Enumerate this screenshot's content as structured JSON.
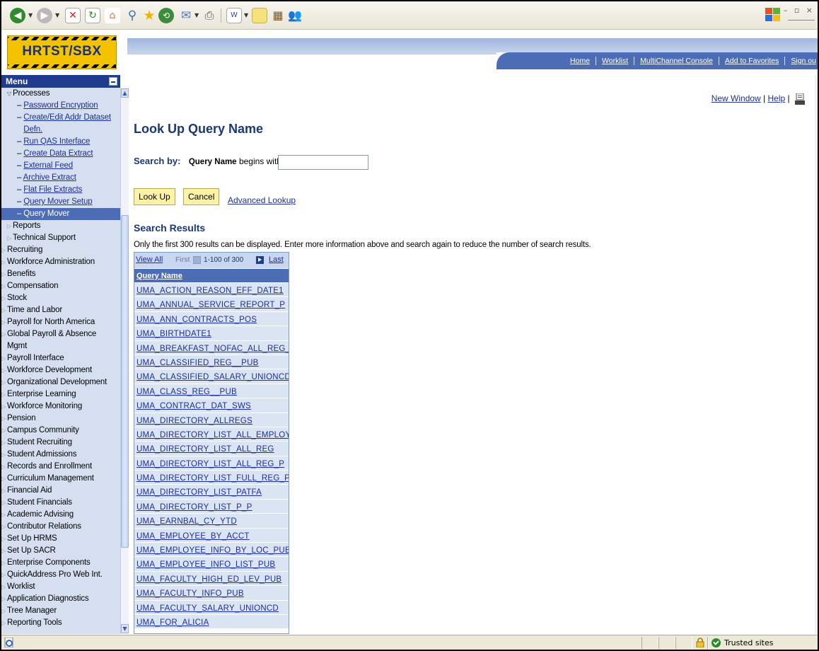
{
  "app": {
    "logo_text": "HRTST/SBX"
  },
  "header_nav": {
    "links": [
      "Home",
      "Worklist",
      "MultiChannel Console",
      "Add to Favorites",
      "Sign ou"
    ]
  },
  "window_controls": "– ▫ ×",
  "menu": {
    "title": "Menu",
    "items": [
      {
        "label": "Processes",
        "level": 1,
        "type": "folder-open"
      },
      {
        "label": "Password Encryption",
        "level": 2,
        "type": "link"
      },
      {
        "label": "Create/Edit Addr Dataset Defn.",
        "level": 2,
        "type": "link",
        "wrap": true
      },
      {
        "label": "Run QAS Interface",
        "level": 2,
        "type": "link"
      },
      {
        "label": "Create Data Extract",
        "level": 2,
        "type": "link"
      },
      {
        "label": "External Feed",
        "level": 2,
        "type": "link"
      },
      {
        "label": "Archive Extract",
        "level": 2,
        "type": "link"
      },
      {
        "label": "Flat File Extracts",
        "level": 2,
        "type": "link"
      },
      {
        "label": "Query Mover Setup",
        "level": 2,
        "type": "link"
      },
      {
        "label": "Query Mover",
        "level": 2,
        "type": "link",
        "active": true
      },
      {
        "label": "Reports",
        "level": 1,
        "type": "folder"
      },
      {
        "label": "Technical Support",
        "level": 1,
        "type": "folder"
      },
      {
        "label": "Recruiting",
        "level": 0,
        "type": "folder"
      },
      {
        "label": "Workforce Administration",
        "level": 0,
        "type": "folder"
      },
      {
        "label": "Benefits",
        "level": 0,
        "type": "folder"
      },
      {
        "label": "Compensation",
        "level": 0,
        "type": "folder"
      },
      {
        "label": "Stock",
        "level": 0,
        "type": "folder"
      },
      {
        "label": "Time and Labor",
        "level": 0,
        "type": "folder"
      },
      {
        "label": "Payroll for North America",
        "level": 0,
        "type": "folder"
      },
      {
        "label": "Global Payroll & Absence Mgmt",
        "level": 0,
        "type": "folder",
        "wrap": true
      },
      {
        "label": "Payroll Interface",
        "level": 0,
        "type": "folder"
      },
      {
        "label": "Workforce Development",
        "level": 0,
        "type": "folder"
      },
      {
        "label": "Organizational Development",
        "level": 0,
        "type": "folder"
      },
      {
        "label": "Enterprise Learning",
        "level": 0,
        "type": "folder"
      },
      {
        "label": "Workforce Monitoring",
        "level": 0,
        "type": "folder"
      },
      {
        "label": "Pension",
        "level": 0,
        "type": "folder"
      },
      {
        "label": "Campus Community",
        "level": 0,
        "type": "folder"
      },
      {
        "label": "Student Recruiting",
        "level": 0,
        "type": "folder"
      },
      {
        "label": "Student Admissions",
        "level": 0,
        "type": "folder"
      },
      {
        "label": "Records and Enrollment",
        "level": 0,
        "type": "folder"
      },
      {
        "label": "Curriculum Management",
        "level": 0,
        "type": "folder"
      },
      {
        "label": "Financial Aid",
        "level": 0,
        "type": "folder"
      },
      {
        "label": "Student Financials",
        "level": 0,
        "type": "folder"
      },
      {
        "label": "Academic Advising",
        "level": 0,
        "type": "folder"
      },
      {
        "label": "Contributor Relations",
        "level": 0,
        "type": "folder"
      },
      {
        "label": "Set Up HRMS",
        "level": 0,
        "type": "folder"
      },
      {
        "label": "Set Up SACR",
        "level": 0,
        "type": "folder"
      },
      {
        "label": "Enterprise Components",
        "level": 0,
        "type": "folder"
      },
      {
        "label": "QuickAddress Pro Web Int.",
        "level": 0,
        "type": "folder"
      },
      {
        "label": "Worklist",
        "level": 0,
        "type": "folder"
      },
      {
        "label": "Application Diagnostics",
        "level": 0,
        "type": "folder"
      },
      {
        "label": "Tree Manager",
        "level": 0,
        "type": "folder"
      },
      {
        "label": "Reporting Tools",
        "level": 0,
        "type": "folder"
      }
    ]
  },
  "page": {
    "new_window": "New Window",
    "help": "Help",
    "title": "Look Up Query Name",
    "search_by_label": "Search by:",
    "search_field": "Query Name",
    "search_op": "begins with",
    "search_value": "",
    "lookup_button": "Look Up",
    "cancel_button": "Cancel",
    "advanced_lookup": "Advanced Lookup",
    "results_title": "Search Results",
    "results_note": "Only the first 300 results can be displayed. Enter more information above and search again to reduce the number of search results."
  },
  "grid": {
    "view_all": "View All",
    "first": "First",
    "range": "1-100 of 300",
    "last": "Last",
    "column_header": "Query Name",
    "rows": [
      "UMA_ACTION_REASON_EFF_DATE1",
      "UMA_ANNUAL_SERVICE_REPORT_P",
      "UMA_ANN_CONTRACTS_POS",
      "UMA_BIRTHDATE1",
      "UMA_BREAKFAST_NOFAC_ALL_REG_P",
      "UMA_CLASSIFIED_REG__PUB",
      "UMA_CLASSIFIED_SALARY_UNIONCD",
      "UMA_CLASS_REG__PUB",
      "UMA_CONTRACT_DAT_SWS",
      "UMA_DIRECTORY_ALLREGS",
      "UMA_DIRECTORY_LIST_ALL_EMPLOYE",
      "UMA_DIRECTORY_LIST_ALL_REG",
      "UMA_DIRECTORY_LIST_ALL_REG_P",
      "UMA_DIRECTORY_LIST_FULL_REG_P",
      "UMA_DIRECTORY_LIST_PATFA",
      "UMA_DIRECTORY_LIST_P_P",
      "UMA_EARNBAL_CY_YTD",
      "UMA_EMPLOYEE_BY_ACCT",
      "UMA_EMPLOYEE_INFO_BY_LOC_PUB",
      "UMA_EMPLOYEE_INFO_LIST_PUB",
      "UMA_FACULTY_HIGH_ED_LEV_PUB",
      "UMA_FACULTY_INFO_PUB",
      "UMA_FACULTY_SALARY_UNIONCD",
      "UMA_FOR_ALICIA"
    ]
  },
  "status_bar": {
    "zone": "Trusted sites"
  }
}
